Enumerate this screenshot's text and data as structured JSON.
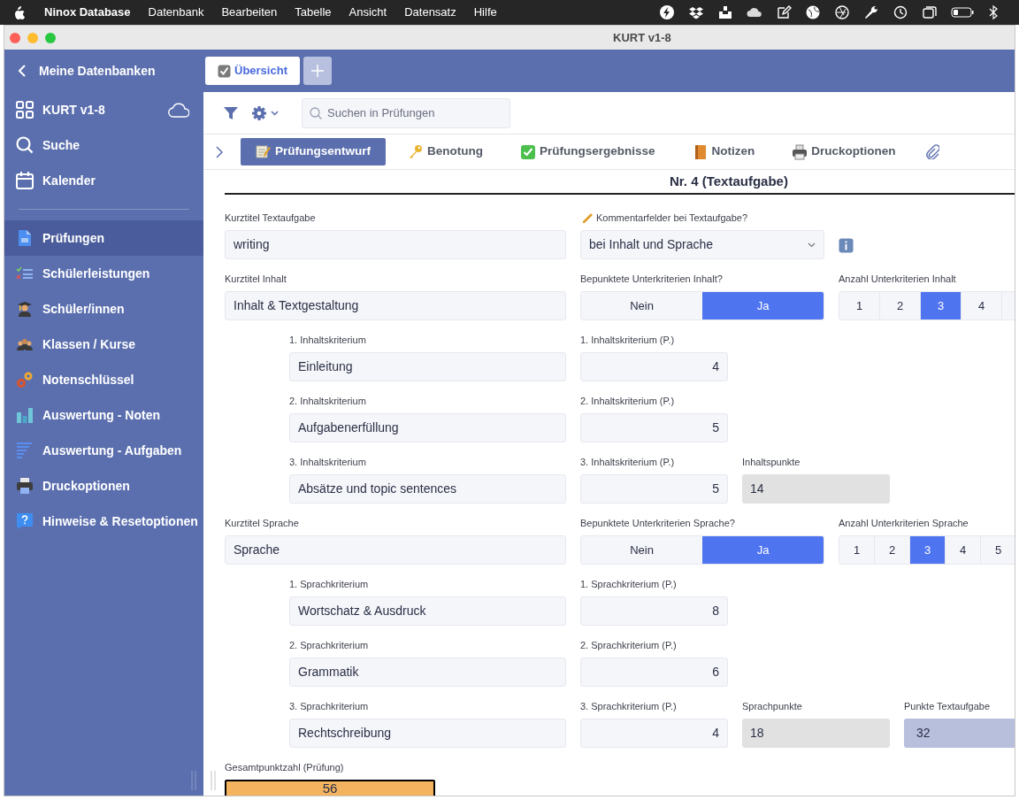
{
  "menubar": {
    "app": "Ninox Database",
    "menus": [
      "Datenbank",
      "Bearbeiten",
      "Tabelle",
      "Ansicht",
      "Datensatz",
      "Hilfe"
    ]
  },
  "window": {
    "title": "KURT v1-8"
  },
  "sidebar": {
    "back": "Meine Datenbanken",
    "database": "KURT v1-8",
    "tools": [
      "Suche",
      "Kalender"
    ],
    "items": [
      {
        "label": "Prüfungen",
        "selected": true
      },
      {
        "label": "Schülerleistungen",
        "selected": false
      },
      {
        "label": "Schüler/innen",
        "selected": false
      },
      {
        "label": "Klassen / Kurse",
        "selected": false
      },
      {
        "label": "Notenschlüssel",
        "selected": false
      },
      {
        "label": "Auswertung - Noten",
        "selected": false
      },
      {
        "label": "Auswertung - Aufgaben",
        "selected": false
      },
      {
        "label": "Druckoptionen",
        "selected": false
      },
      {
        "label": "Hinweise & Resetoptionen",
        "selected": false
      }
    ]
  },
  "tabs": [
    {
      "label": "Übersicht",
      "selected": true
    }
  ],
  "search": {
    "placeholder": "Suchen in Prüfungen"
  },
  "subtabs": [
    {
      "label": "Prüfungsentwurf",
      "selected": true
    },
    {
      "label": "Benotung",
      "selected": false
    },
    {
      "label": "Prüfungsergebnisse",
      "selected": false
    },
    {
      "label": "Notizen",
      "selected": false
    },
    {
      "label": "Druckoptionen",
      "selected": false
    }
  ],
  "heading": "Nr. 4 (Textaufgabe)",
  "rows": [
    {
      "kind": "main",
      "fields": [
        {
          "kind": "text",
          "label": "Kurztitel Textaufgabe",
          "value": "writing"
        },
        {
          "kind": "select",
          "label": "Kommentarfelder bei Textaufgabe?",
          "value": "bei Inhalt und Sprache"
        },
        {
          "kind": "info"
        }
      ]
    },
    {
      "kind": "main",
      "fields": [
        {
          "kind": "text",
          "label": "Kurztitel Inhalt",
          "value": "Inhalt & Textgestaltung"
        },
        {
          "kind": "toggle",
          "label": "Bepunktete Unterkriterien Inhalt?",
          "options": [
            {
              "label": "Nein",
              "selected": false
            },
            {
              "label": "Ja",
              "selected": true
            }
          ]
        },
        {
          "kind": "segments",
          "label": "Anzahl Unterkriterien Inhalt",
          "options": [
            {
              "label": "1",
              "selected": false
            },
            {
              "label": "2",
              "selected": false
            },
            {
              "label": "3",
              "selected": true
            },
            {
              "label": "4",
              "selected": false
            }
          ]
        }
      ]
    },
    {
      "kind": "criterion",
      "fields": [
        {
          "kind": "text",
          "label": "1. Inhaltskriterium",
          "value": "Einleitung"
        },
        {
          "kind": "number",
          "label": "1. Inhaltskriterium (P.)",
          "value": "4"
        }
      ]
    },
    {
      "kind": "criterion",
      "fields": [
        {
          "kind": "text",
          "label": "2. Inhaltskriterium",
          "value": "Aufgabenerfüllung"
        },
        {
          "kind": "number",
          "label": "2. Inhaltskriterium (P.)",
          "value": "5"
        }
      ]
    },
    {
      "kind": "criterion",
      "fields": [
        {
          "kind": "text",
          "label": "3. Inhaltskriterium",
          "value": "Absätze und topic sentences"
        },
        {
          "kind": "number",
          "label": "3. Inhaltskriterium (P.)",
          "value": "5"
        },
        {
          "kind": "computed",
          "label": "Inhaltspunkte",
          "value": "14"
        }
      ]
    },
    {
      "kind": "main",
      "fields": [
        {
          "kind": "text",
          "label": "Kurztitel Sprache",
          "value": "Sprache"
        },
        {
          "kind": "toggle",
          "label": "Bepunktete Unterkriterien Sprache?",
          "options": [
            {
              "label": "Nein",
              "selected": false
            },
            {
              "label": "Ja",
              "selected": true
            }
          ]
        },
        {
          "kind": "segments",
          "label": "Anzahl Unterkriterien Sprache",
          "options": [
            {
              "label": "1",
              "selected": false
            },
            {
              "label": "2",
              "selected": false
            },
            {
              "label": "3",
              "selected": true
            },
            {
              "label": "4",
              "selected": false
            },
            {
              "label": "5",
              "selected": false
            }
          ]
        }
      ]
    },
    {
      "kind": "criterion",
      "fields": [
        {
          "kind": "text",
          "label": "1. Sprachkriterium",
          "value": "Wortschatz & Ausdruck"
        },
        {
          "kind": "number",
          "label": "1. Sprachkriterium (P.)",
          "value": "8"
        }
      ]
    },
    {
      "kind": "criterion",
      "fields": [
        {
          "kind": "text",
          "label": "2. Sprachkriterium",
          "value": "Grammatik"
        },
        {
          "kind": "number",
          "label": "2. Sprachkriterium (P.)",
          "value": "6"
        }
      ]
    },
    {
      "kind": "criterion",
      "fields": [
        {
          "kind": "text",
          "label": "3. Sprachkriterium",
          "value": "Rechtschreibung"
        },
        {
          "kind": "number",
          "label": "3. Sprachkriterium (P.)",
          "value": "4"
        },
        {
          "kind": "computed",
          "label": "Sprachpunkte",
          "value": "18"
        },
        {
          "kind": "total",
          "label": "Punkte Textaufgabe",
          "value": "32"
        }
      ]
    },
    {
      "kind": "main",
      "fields": [
        {
          "kind": "grand_total",
          "label": "Gesamtpunktzahl (Prüfung)",
          "value": "56"
        }
      ]
    }
  ]
}
